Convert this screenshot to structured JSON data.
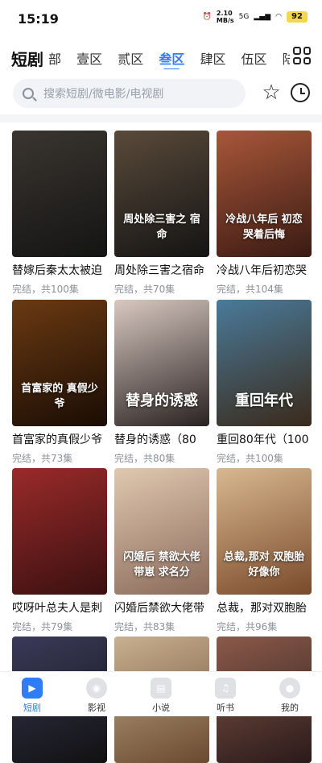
{
  "status_bar": {
    "time": "15:19",
    "net_speed_value": "2.10",
    "net_speed_unit": "MB/s",
    "signal": "5G",
    "battery": "92"
  },
  "header": {
    "brand": "短剧",
    "tabs": [
      "部",
      "壹区",
      "贰区",
      "叁区",
      "肆区",
      "伍区",
      "陆区"
    ],
    "active_tab": 3,
    "grid_icon": "grid-icon"
  },
  "search": {
    "placeholder": "搜索短剧/微电影/电视剧",
    "icon": "search-icon"
  },
  "actions": {
    "favorite_icon": "star-icon",
    "history_icon": "clock-icon"
  },
  "cards": [
    {
      "title": "替嫁后秦太太被迫",
      "meta": "完结，共100集",
      "poster_text": "",
      "colors": [
        "#3a3530",
        "#141414"
      ]
    },
    {
      "title": "周处除三害之宿命",
      "meta": "完结，共70集",
      "poster_text": "周处除三害之 宿命",
      "colors": [
        "#5a4a3a",
        "#141414"
      ]
    },
    {
      "title": "冷战八年后初恋哭",
      "meta": "完结，共104集",
      "poster_text": "冷战八年后 初恋哭着后悔",
      "colors": [
        "#a8573a",
        "#3a1a12"
      ]
    },
    {
      "title": "首富家的真假少爷",
      "meta": "完结，共73集",
      "poster_text": "首富家的 真假少爷",
      "colors": [
        "#6a3a12",
        "#1a0c04"
      ]
    },
    {
      "title": "替身的诱惑（80",
      "meta": "完结，共80集",
      "poster_text": "替身的诱惑",
      "colors": [
        "#d8c8c0",
        "#2a2222"
      ]
    },
    {
      "title": "重回80年代（100",
      "meta": "完结，共100集",
      "poster_text": "重回年代",
      "colors": [
        "#4a7a9a",
        "#3a2a1a"
      ]
    },
    {
      "title": "哎呀叶总夫人是刺",
      "meta": "完结，共79集",
      "poster_text": "",
      "colors": [
        "#9a2a2a",
        "#3a1010"
      ]
    },
    {
      "title": "闪婚后禁欲大佬带",
      "meta": "完结，共83集",
      "poster_text": "闪婚后 禁欲大佬带崽 求名分",
      "colors": [
        "#e0c8b0",
        "#8a6a5a"
      ]
    },
    {
      "title": "总裁，那对双胞胎",
      "meta": "完结，共96集",
      "poster_text": "总裁,那对 双胞胎好像你",
      "colors": [
        "#d8b890",
        "#7a4a2a"
      ]
    },
    {
      "title": "",
      "meta": "",
      "poster_text": "",
      "colors": [
        "#3a3a5a",
        "#111111"
      ]
    },
    {
      "title": "",
      "meta": "",
      "poster_text": "",
      "colors": [
        "#c8b090",
        "#6a4a30"
      ]
    },
    {
      "title": "",
      "meta": "",
      "poster_text": "",
      "colors": [
        "#8a5a4a",
        "#2a1a1a"
      ]
    }
  ],
  "nav": [
    {
      "label": "短剧",
      "icon": "play-icon",
      "active": true
    },
    {
      "label": "影视",
      "icon": "film-reel-icon",
      "active": false
    },
    {
      "label": "小说",
      "icon": "book-icon",
      "active": false
    },
    {
      "label": "听书",
      "icon": "headphone-book-icon",
      "active": false
    },
    {
      "label": "我的",
      "icon": "user-icon",
      "active": false
    }
  ],
  "colors": {
    "accent": "#2f7cf6",
    "muted_text": "#8d9199",
    "search_bg": "#f1f3f7"
  }
}
